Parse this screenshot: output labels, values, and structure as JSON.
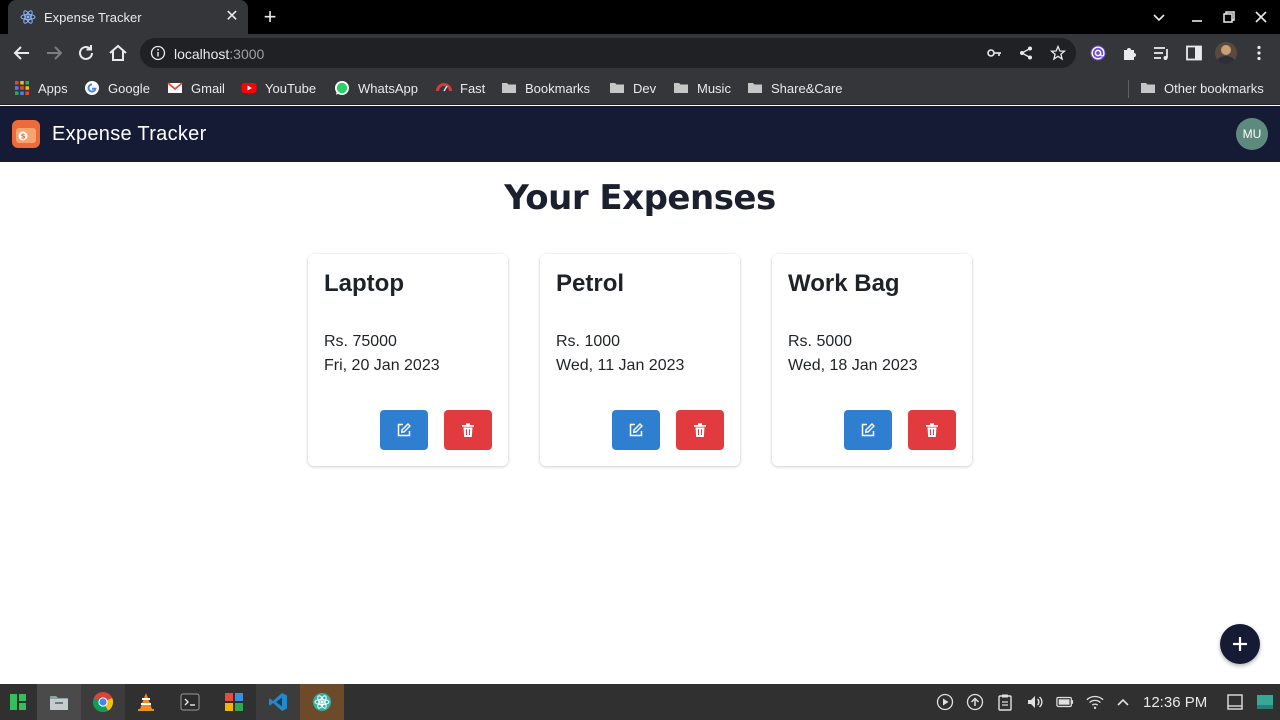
{
  "browser": {
    "tab": {
      "title": "Expense Tracker",
      "favicon": "react-icon"
    },
    "url": {
      "host": "localhost",
      "port": ":3000"
    },
    "bookmarks": [
      {
        "label": "Apps",
        "icon": "apps-grid-icon"
      },
      {
        "label": "Google",
        "icon": "google-icon"
      },
      {
        "label": "Gmail",
        "icon": "gmail-icon"
      },
      {
        "label": "YouTube",
        "icon": "youtube-icon"
      },
      {
        "label": "WhatsApp",
        "icon": "whatsapp-icon"
      },
      {
        "label": "Fast",
        "icon": "speedometer-icon"
      },
      {
        "label": "Bookmarks",
        "icon": "folder-icon"
      },
      {
        "label": "Dev",
        "icon": "folder-icon"
      },
      {
        "label": "Music",
        "icon": "folder-icon"
      },
      {
        "label": "Share&Care",
        "icon": "folder-icon"
      }
    ],
    "other_bookmarks": "Other bookmarks"
  },
  "app": {
    "title": "Expense Tracker",
    "avatar_initials": "MU",
    "heading": "Your Expenses",
    "colors": {
      "appbar": "#151a35",
      "edit": "#2f7fd1",
      "delete": "#e23b3f"
    },
    "expenses": [
      {
        "title": "Laptop",
        "amount": "Rs. 75000",
        "date": "Fri, 20 Jan 2023"
      },
      {
        "title": "Petrol",
        "amount": "Rs. 1000",
        "date": "Wed, 11 Jan 2023"
      },
      {
        "title": "Work Bag",
        "amount": "Rs. 5000",
        "date": "Wed, 18 Jan 2023"
      }
    ]
  },
  "taskbar": {
    "time": "12:36 PM",
    "apps": [
      "manjaro-icon",
      "files-icon",
      "chrome-icon",
      "vlc-icon",
      "terminal-icon",
      "app-store-icon",
      "vscode-icon",
      "react-icon"
    ]
  }
}
